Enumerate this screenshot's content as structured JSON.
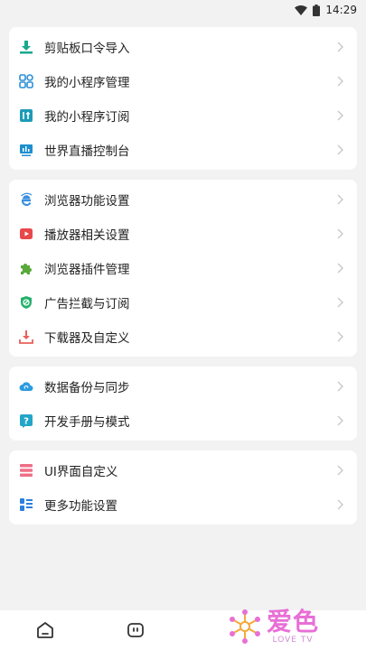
{
  "status": {
    "time": "14:29"
  },
  "groups": [
    {
      "items": [
        {
          "label": "剪贴板口令导入",
          "icon": "clipboard-import-icon"
        },
        {
          "label": "我的小程序管理",
          "icon": "miniapp-grid-icon"
        },
        {
          "label": "我的小程序订阅",
          "icon": "miniapp-subscribe-icon"
        },
        {
          "label": "世界直播控制台",
          "icon": "live-console-icon"
        }
      ]
    },
    {
      "items": [
        {
          "label": "浏览器功能设置",
          "icon": "browser-e-icon"
        },
        {
          "label": "播放器相关设置",
          "icon": "player-icon"
        },
        {
          "label": "浏览器插件管理",
          "icon": "puzzle-plugin-icon"
        },
        {
          "label": "广告拦截与订阅",
          "icon": "shield-block-icon"
        },
        {
          "label": "下载器及自定义",
          "icon": "download-icon"
        }
      ]
    },
    {
      "items": [
        {
          "label": "数据备份与同步",
          "icon": "cloud-sync-icon"
        },
        {
          "label": "开发手册与模式",
          "icon": "help-question-icon"
        }
      ]
    },
    {
      "items": [
        {
          "label": "UI界面自定义",
          "icon": "ui-layers-icon"
        },
        {
          "label": "更多功能设置",
          "icon": "more-settings-icon"
        }
      ]
    }
  ],
  "watermark": {
    "main": "爱色",
    "sub": "LOVE TV"
  }
}
